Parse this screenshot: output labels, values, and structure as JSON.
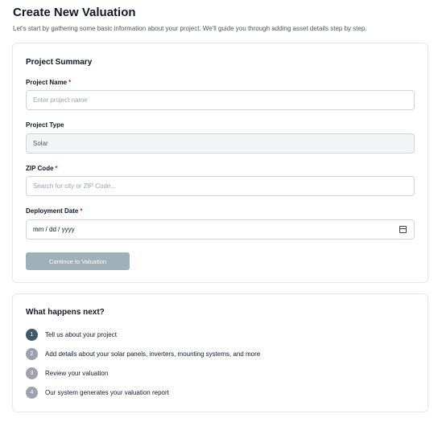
{
  "header": {
    "title": "Create New Valuation",
    "subtitle": "Let's start by gathering some basic information about your project. We'll guide you through adding asset details step by step."
  },
  "summary": {
    "title": "Project Summary",
    "project_name": {
      "label": "Project Name",
      "required_mark": "*",
      "placeholder": "Enter project name"
    },
    "project_type": {
      "label": "Project Type",
      "value": "Solar"
    },
    "zip_code": {
      "label": "ZIP Code",
      "required_mark": "*",
      "placeholder": "Search for city or ZIP Code..."
    },
    "deployment_date": {
      "label": "Deployment Date",
      "required_mark": "*",
      "value": "mm / dd / yyyy",
      "icon": "calendar-icon"
    },
    "continue_label": "Continue to Valuation"
  },
  "next": {
    "title": "What happens next?",
    "steps": [
      {
        "num": "1",
        "text": "Tell us about your project"
      },
      {
        "num": "2",
        "text": "Add details about your solar panels, inverters, mounting systems, and more"
      },
      {
        "num": "3",
        "text": "Review your valuation"
      },
      {
        "num": "4",
        "text": "Our system generates your valuation report"
      }
    ]
  },
  "colors": {
    "accent": "#3d5b66",
    "button_disabled": "#9fb0b8",
    "required": "#dc2626",
    "step_inactive": "#9ca3af"
  }
}
